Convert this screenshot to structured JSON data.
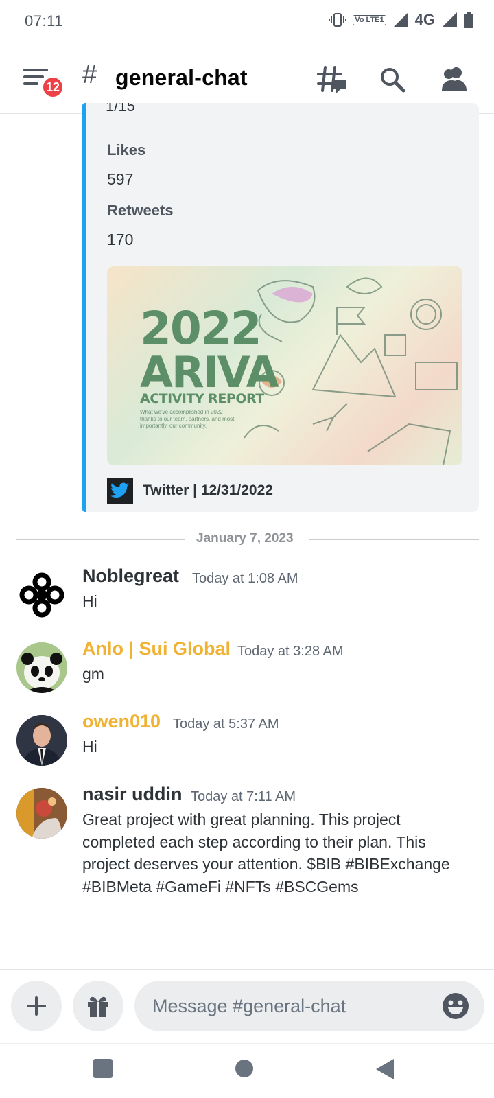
{
  "status_bar": {
    "time": "07:11",
    "volte_label": "Vo LTE1",
    "network": "4G"
  },
  "header": {
    "badge_count": "12",
    "hash_symbol": "#",
    "channel_name": "general-chat"
  },
  "embed": {
    "truncated_value": "1/15",
    "fields": [
      {
        "name": "Likes",
        "value": "597"
      },
      {
        "name": "Retweets",
        "value": "170"
      }
    ],
    "image": {
      "year": "2022",
      "name": "ARIVA",
      "subtitle": "ACTIVITY REPORT",
      "note": "What we've accomplished in 2022 thanks to our team, partners, and most importantly, our community."
    },
    "footer": "Twitter | 12/31/2022",
    "accent_color": "#1da1f2"
  },
  "date_divider": "January 7, 2023",
  "messages": [
    {
      "author": "Noblegreat",
      "author_color": "#2e3338",
      "timestamp": "Today at 1:08 AM",
      "text": "Hi"
    },
    {
      "author": "Anlo | Sui Global",
      "author_color": "#f0b232",
      "timestamp": "Today at 3:28 AM",
      "text": "gm"
    },
    {
      "author": "owen010",
      "author_color": "#f0b232",
      "timestamp": "Today at 5:37 AM",
      "text": "Hi"
    },
    {
      "author": "nasir uddin",
      "author_color": "#2e3338",
      "timestamp": "Today at 7:11 AM",
      "text": "Great project with great planning. This project completed each step according to their plan. This project deserves your attention. $BIB #BIBExchange #BIBMeta #GameFi #NFTs #BSCGems"
    }
  ],
  "composer": {
    "placeholder": "Message #general-chat"
  },
  "icons": {
    "menu": "menu-icon",
    "threads": "threads-icon",
    "search": "search-icon",
    "members": "members-icon",
    "plus": "plus-icon",
    "gift": "gift-icon",
    "emoji": "emoji-icon",
    "nav_recents": "square-icon",
    "nav_home": "circle-icon",
    "nav_back": "triangle-back-icon"
  }
}
